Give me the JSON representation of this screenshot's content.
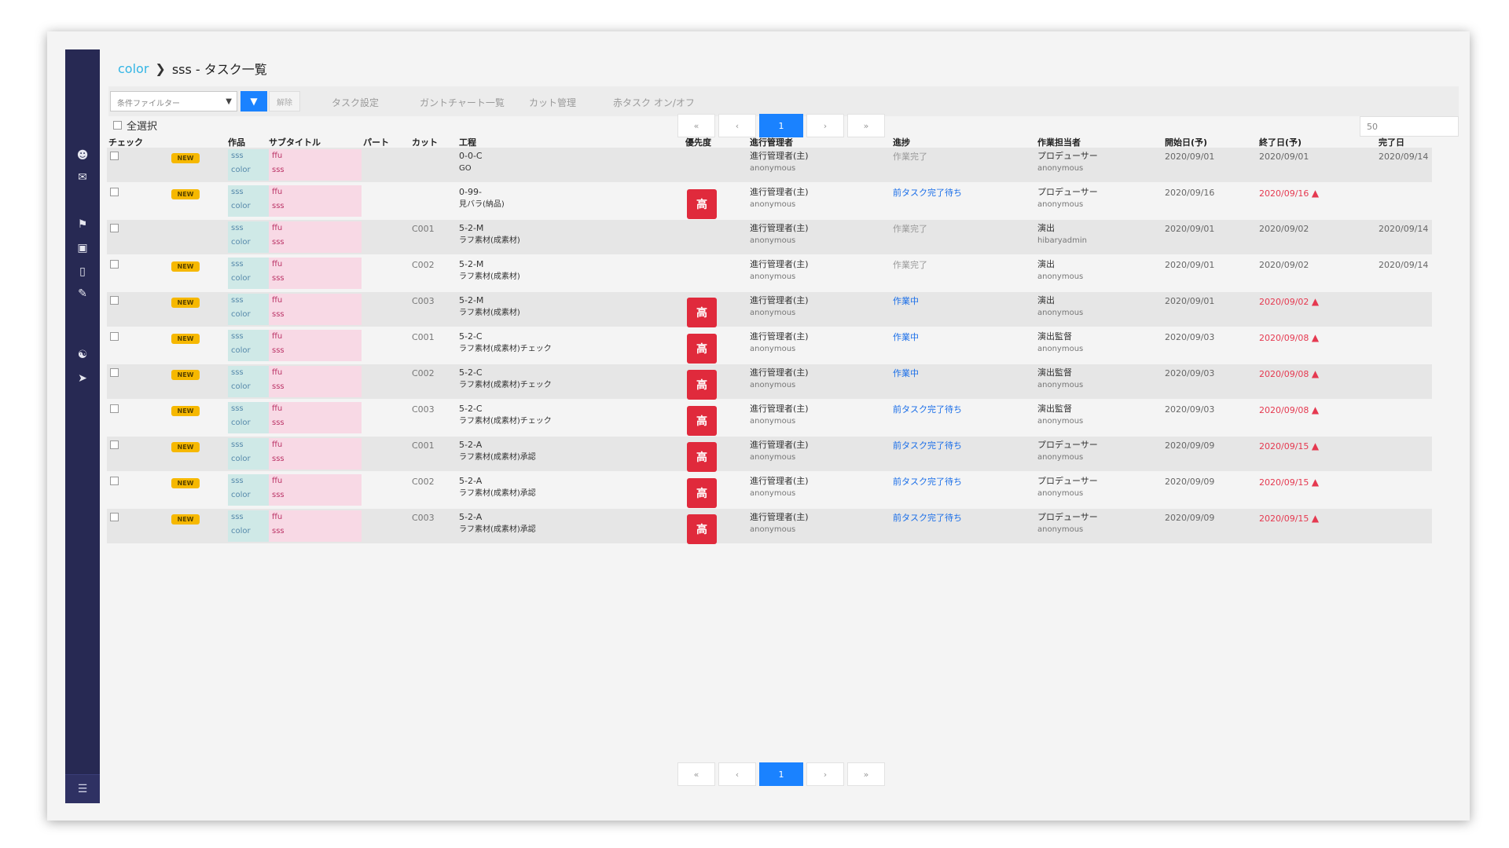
{
  "breadcrumb": {
    "root": "color",
    "current": "sss - タスク一覧"
  },
  "toolbar": {
    "filter_placeholder": "条件ファイルター",
    "clear_label": "解除",
    "links": [
      "タスク設定",
      "ガントチャート一覧",
      "カット管理",
      "赤タスク オン/オフ"
    ]
  },
  "select_all_label": "全選択",
  "pagination": {
    "first": "«",
    "prev": "‹",
    "current": "1",
    "next": "›",
    "last": "»"
  },
  "per_page": "50",
  "table": {
    "headers": {
      "check": "チェック",
      "work": "作品",
      "subtitle": "サブタイトル",
      "part": "パート",
      "cut": "カット",
      "process": "工程",
      "priority": "優先度",
      "manager": "進行管理者",
      "status": "進捗",
      "assignee": "作業担当者",
      "start": "開始日(予)",
      "end": "終了日(予)",
      "done": "完了日"
    },
    "rows": [
      {
        "badge": "NEW",
        "work1": "sss",
        "work2": "color",
        "sub1": "ffu",
        "sub2": "sss",
        "part": "",
        "cut": "",
        "proc1": "0-0-C",
        "proc2": "GO",
        "priority": "",
        "mgr1": "進行管理者(主)",
        "mgr2": "anonymous",
        "status": "作業完了",
        "status_type": "plain",
        "asg1": "プロデューサー",
        "asg2": "anonymous",
        "start": "2020/09/01",
        "end": "2020/09/01",
        "end_late": false,
        "done": "2020/09/14"
      },
      {
        "badge": "NEW",
        "work1": "sss",
        "work2": "color",
        "sub1": "ffu",
        "sub2": "sss",
        "part": "",
        "cut": "",
        "proc1": "0-99-",
        "proc2": "見バラ(納品)",
        "priority": "高",
        "mgr1": "進行管理者(主)",
        "mgr2": "anonymous",
        "status": "前タスク完了待ち",
        "status_type": "link",
        "asg1": "プロデューサー",
        "asg2": "anonymous",
        "start": "2020/09/16",
        "end": "2020/09/16",
        "end_late": true,
        "done": ""
      },
      {
        "badge": "",
        "work1": "sss",
        "work2": "color",
        "sub1": "ffu",
        "sub2": "sss",
        "part": "",
        "cut": "C001",
        "proc1": "5-2-M",
        "proc2": "ラフ素材(成素材)",
        "priority": "",
        "mgr1": "進行管理者(主)",
        "mgr2": "anonymous",
        "status": "作業完了",
        "status_type": "plain",
        "asg1": "演出",
        "asg2": "hibaryadmin",
        "start": "2020/09/01",
        "end": "2020/09/02",
        "end_late": false,
        "done": "2020/09/14"
      },
      {
        "badge": "NEW",
        "work1": "sss",
        "work2": "color",
        "sub1": "ffu",
        "sub2": "sss",
        "part": "",
        "cut": "C002",
        "proc1": "5-2-M",
        "proc2": "ラフ素材(成素材)",
        "priority": "",
        "mgr1": "進行管理者(主)",
        "mgr2": "anonymous",
        "status": "作業完了",
        "status_type": "plain",
        "asg1": "演出",
        "asg2": "anonymous",
        "start": "2020/09/01",
        "end": "2020/09/02",
        "end_late": false,
        "done": "2020/09/14"
      },
      {
        "badge": "NEW",
        "work1": "sss",
        "work2": "color",
        "sub1": "ffu",
        "sub2": "sss",
        "part": "",
        "cut": "C003",
        "proc1": "5-2-M",
        "proc2": "ラフ素材(成素材)",
        "priority": "高",
        "mgr1": "進行管理者(主)",
        "mgr2": "anonymous",
        "status": "作業中",
        "status_type": "link",
        "asg1": "演出",
        "asg2": "anonymous",
        "start": "2020/09/01",
        "end": "2020/09/02",
        "end_late": true,
        "done": ""
      },
      {
        "badge": "NEW",
        "work1": "sss",
        "work2": "color",
        "sub1": "ffu",
        "sub2": "sss",
        "part": "",
        "cut": "C001",
        "proc1": "5-2-C",
        "proc2": "ラフ素材(成素材)チェック",
        "priority": "高",
        "mgr1": "進行管理者(主)",
        "mgr2": "anonymous",
        "status": "作業中",
        "status_type": "link",
        "asg1": "演出監督",
        "asg2": "anonymous",
        "start": "2020/09/03",
        "end": "2020/09/08",
        "end_late": true,
        "done": ""
      },
      {
        "badge": "NEW",
        "work1": "sss",
        "work2": "color",
        "sub1": "ffu",
        "sub2": "sss",
        "part": "",
        "cut": "C002",
        "proc1": "5-2-C",
        "proc2": "ラフ素材(成素材)チェック",
        "priority": "高",
        "mgr1": "進行管理者(主)",
        "mgr2": "anonymous",
        "status": "作業中",
        "status_type": "link",
        "asg1": "演出監督",
        "asg2": "anonymous",
        "start": "2020/09/03",
        "end": "2020/09/08",
        "end_late": true,
        "done": ""
      },
      {
        "badge": "NEW",
        "work1": "sss",
        "work2": "color",
        "sub1": "ffu",
        "sub2": "sss",
        "part": "",
        "cut": "C003",
        "proc1": "5-2-C",
        "proc2": "ラフ素材(成素材)チェック",
        "priority": "高",
        "mgr1": "進行管理者(主)",
        "mgr2": "anonymous",
        "status": "前タスク完了待ち",
        "status_type": "link",
        "asg1": "演出監督",
        "asg2": "anonymous",
        "start": "2020/09/03",
        "end": "2020/09/08",
        "end_late": true,
        "done": ""
      },
      {
        "badge": "NEW",
        "work1": "sss",
        "work2": "color",
        "sub1": "ffu",
        "sub2": "sss",
        "part": "",
        "cut": "C001",
        "proc1": "5-2-A",
        "proc2": "ラフ素材(成素材)承認",
        "priority": "高",
        "mgr1": "進行管理者(主)",
        "mgr2": "anonymous",
        "status": "前タスク完了待ち",
        "status_type": "link",
        "asg1": "プロデューサー",
        "asg2": "anonymous",
        "start": "2020/09/09",
        "end": "2020/09/15",
        "end_late": true,
        "done": ""
      },
      {
        "badge": "NEW",
        "work1": "sss",
        "work2": "color",
        "sub1": "ffu",
        "sub2": "sss",
        "part": "",
        "cut": "C002",
        "proc1": "5-2-A",
        "proc2": "ラフ素材(成素材)承認",
        "priority": "高",
        "mgr1": "進行管理者(主)",
        "mgr2": "anonymous",
        "status": "前タスク完了待ち",
        "status_type": "link",
        "asg1": "プロデューサー",
        "asg2": "anonymous",
        "start": "2020/09/09",
        "end": "2020/09/15",
        "end_late": true,
        "done": ""
      },
      {
        "badge": "NEW",
        "work1": "sss",
        "work2": "color",
        "sub1": "ffu",
        "sub2": "sss",
        "part": "",
        "cut": "C003",
        "proc1": "5-2-A",
        "proc2": "ラフ素材(成素材)承認",
        "priority": "高",
        "mgr1": "進行管理者(主)",
        "mgr2": "anonymous",
        "status": "前タスク完了待ち",
        "status_type": "link",
        "asg1": "プロデューサー",
        "asg2": "anonymous",
        "start": "2020/09/09",
        "end": "2020/09/15",
        "end_late": true,
        "done": ""
      }
    ]
  },
  "sidebar": {
    "icons": [
      "user-icon",
      "mail-icon",
      "flag-icon",
      "calendar-icon",
      "inbox-icon",
      "user-edit-icon",
      "users-icon",
      "logout-icon"
    ],
    "collapse_icon": "menu-icon"
  },
  "colors": {
    "sidebar": "#272953",
    "accent": "#1a82ff",
    "priority": "#e02a3c",
    "badge": "#f6b800",
    "late": "#e53950"
  }
}
